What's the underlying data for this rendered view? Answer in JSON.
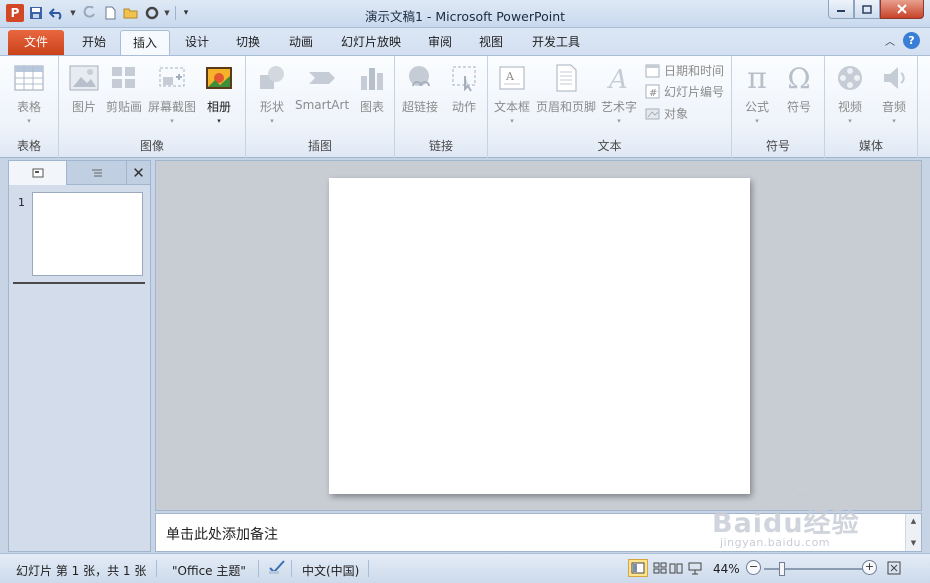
{
  "window": {
    "title": "演示文稿1 - Microsoft PowerPoint",
    "app_icon": "powerpoint-icon",
    "app_icon_letter": "P"
  },
  "quick_access": [
    "save-icon",
    "undo-icon",
    "redo-icon",
    "new-icon",
    "open-icon",
    "customize-icon"
  ],
  "tabs": {
    "file": "文件",
    "items": [
      "开始",
      "插入",
      "设计",
      "切换",
      "动画",
      "幻灯片放映",
      "审阅",
      "视图",
      "开发工具"
    ],
    "active": "插入",
    "help": "?"
  },
  "ribbon": {
    "groups": [
      {
        "label": "表格",
        "buttons": [
          {
            "label": "表格",
            "icon": "table-icon"
          }
        ]
      },
      {
        "label": "图像",
        "buttons": [
          {
            "label": "图片",
            "icon": "picture-icon"
          },
          {
            "label": "剪贴画",
            "icon": "clipart-icon"
          },
          {
            "label": "屏幕截图",
            "icon": "screenshot-icon"
          },
          {
            "label": "相册",
            "icon": "photo-album-icon"
          }
        ]
      },
      {
        "label": "插图",
        "buttons": [
          {
            "label": "形状",
            "icon": "shapes-icon"
          },
          {
            "label": "SmartArt",
            "icon": "smartart-icon"
          },
          {
            "label": "图表",
            "icon": "chart-icon"
          }
        ]
      },
      {
        "label": "链接",
        "buttons": [
          {
            "label": "超链接",
            "icon": "hyperlink-icon"
          },
          {
            "label": "动作",
            "icon": "action-icon"
          }
        ]
      },
      {
        "label": "文本",
        "buttons": [
          {
            "label": "文本框",
            "icon": "textbox-icon"
          },
          {
            "label": "页眉和页脚",
            "icon": "header-footer-icon"
          },
          {
            "label": "艺术字",
            "icon": "wordart-icon"
          }
        ],
        "small_buttons": [
          {
            "label": "日期和时间",
            "icon": "date-time-icon"
          },
          {
            "label": "幻灯片编号",
            "icon": "slide-number-icon"
          },
          {
            "label": "对象",
            "icon": "object-icon"
          }
        ]
      },
      {
        "label": "符号",
        "buttons": [
          {
            "label": "公式",
            "icon": "equation-icon",
            "glyph": "π"
          },
          {
            "label": "符号",
            "icon": "symbol-icon",
            "glyph": "Ω"
          }
        ]
      },
      {
        "label": "媒体",
        "buttons": [
          {
            "label": "视频",
            "icon": "video-icon"
          },
          {
            "label": "音频",
            "icon": "audio-icon"
          }
        ]
      }
    ]
  },
  "slides_pane": {
    "slide_number": "1",
    "close_glyph": "✕"
  },
  "notes": {
    "placeholder": "单击此处添加备注"
  },
  "status": {
    "slide_info": "幻灯片 第 1 张，共 1 张",
    "theme": "\"Office 主题\"",
    "language": "中文(中国)",
    "zoom": "44%",
    "zoom_out": "−",
    "zoom_in": "+"
  },
  "watermark": {
    "text": "Baidu经验",
    "url": "jingyan.baidu.com"
  },
  "colors": {
    "file_tab": "#d24726",
    "accent": "#3a7fd5"
  }
}
